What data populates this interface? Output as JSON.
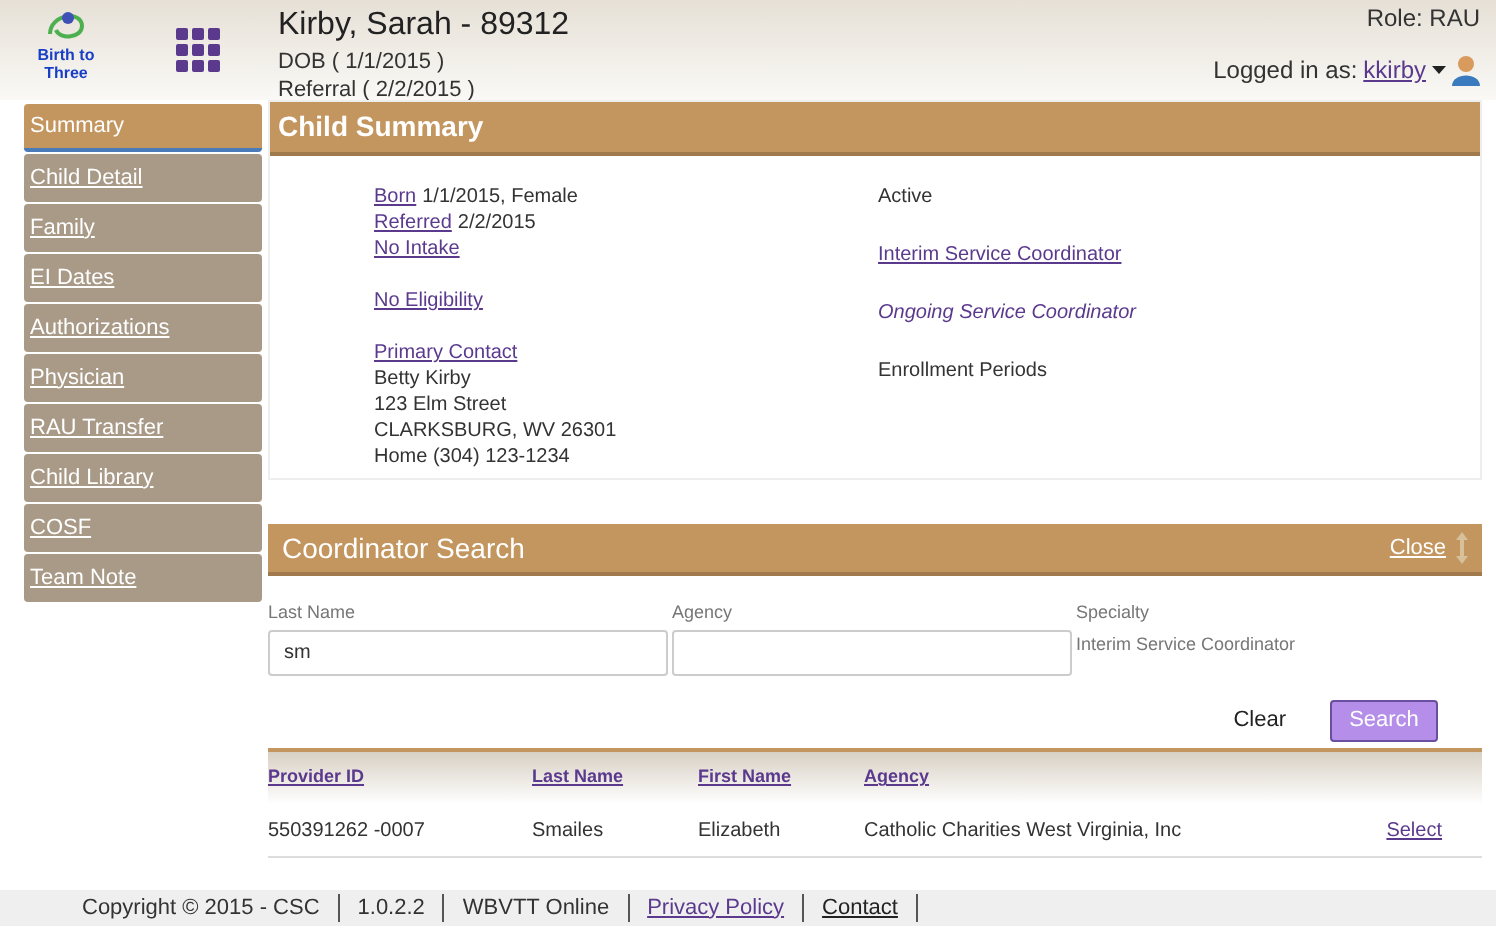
{
  "header": {
    "logo_text": "Birth to Three",
    "patient": "Kirby, Sarah - 89312",
    "dob": "DOB ( 1/1/2015 )",
    "referral": "Referral ( 2/2/2015 )",
    "role": "Role: RAU",
    "logged_in_label": "Logged in as:",
    "user": "kkirby"
  },
  "sidebar": {
    "items": [
      {
        "label": "Summary",
        "selected": true
      },
      {
        "label": "Child Detail",
        "selected": false
      },
      {
        "label": "Family",
        "selected": false
      },
      {
        "label": "EI Dates",
        "selected": false
      },
      {
        "label": "Authorizations",
        "selected": false
      },
      {
        "label": "Physician",
        "selected": false
      },
      {
        "label": "RAU Transfer",
        "selected": false
      },
      {
        "label": "Child Library",
        "selected": false
      },
      {
        "label": "COSF",
        "selected": false
      },
      {
        "label": "Team Note",
        "selected": false
      }
    ]
  },
  "summary": {
    "title": "Child Summary",
    "left_blocks": [
      [
        {
          "link": "Born",
          "text": "1/1/2015, Female"
        },
        {
          "link": "Referred",
          "text": "2/2/2015"
        },
        {
          "link": "No Intake"
        }
      ],
      [
        {
          "link": "No Eligibility"
        }
      ],
      [
        {
          "link": "Primary Contact"
        },
        {
          "text": "Betty Kirby"
        },
        {
          "text": "123 Elm Street"
        },
        {
          "text": "CLARKSBURG, WV 26301"
        },
        {
          "text": "Home (304) 123-1234"
        }
      ]
    ],
    "right_items": [
      {
        "kind": "text",
        "label": "Active"
      },
      {
        "kind": "link",
        "label": "Interim Service Coordinator"
      },
      {
        "kind": "italic",
        "label": "Ongoing Service Coordinator"
      },
      {
        "kind": "text",
        "label": "Enrollment Periods"
      }
    ]
  },
  "coordinator_search": {
    "title": "Coordinator Search",
    "close": "Close",
    "fields": [
      {
        "kind": "input",
        "label": "Last Name",
        "value": "sm"
      },
      {
        "kind": "input",
        "label": "Agency"
      },
      {
        "kind": "static",
        "label": "Specialty",
        "value": "Interim Service Coordinator"
      }
    ],
    "buttons": [
      "Clear",
      "Search"
    ],
    "table": {
      "columns": [
        "Provider ID",
        "Last Name",
        "First Name",
        "Agency"
      ],
      "rows": [
        {
          "cells": [
            "550391262 -0007",
            "Smailes",
            "Elizabeth",
            "Catholic Charities West Virginia, Inc"
          ],
          "action": "Select"
        }
      ]
    }
  },
  "footer": [
    {
      "kind": "text",
      "label": "Copyright © 2015 - CSC"
    },
    {
      "kind": "text",
      "label": "1.0.2.2"
    },
    {
      "kind": "text",
      "label": "WBVTT Online"
    },
    {
      "kind": "link",
      "label": "Privacy Policy"
    },
    {
      "kind": "dark-link",
      "label": "Contact"
    }
  ]
}
